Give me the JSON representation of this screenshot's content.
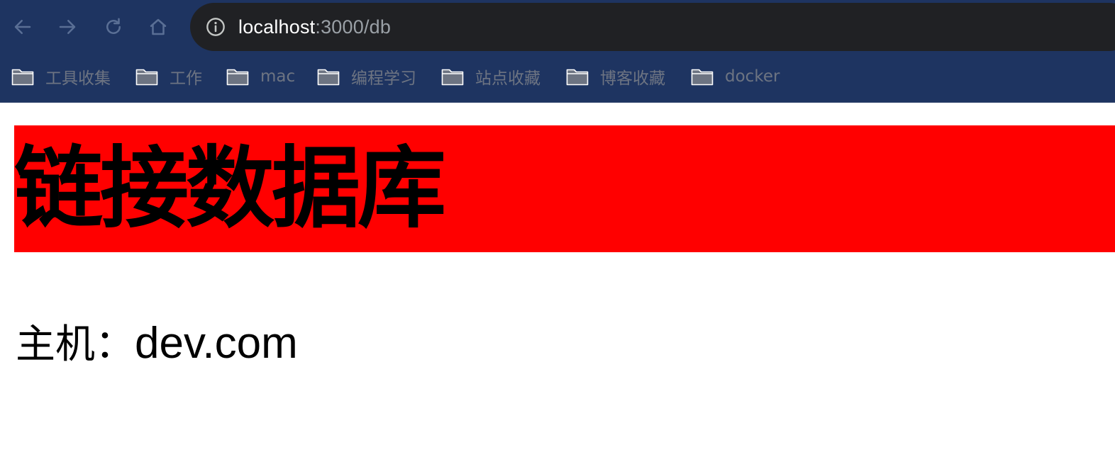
{
  "browser": {
    "address_bar": {
      "host": "localhost",
      "path": ":3000/db"
    },
    "bookmarks": [
      {
        "label": "工具收集",
        "icon": "folder-icon"
      },
      {
        "label": "工作",
        "icon": "folder-icon"
      },
      {
        "label": "mac",
        "icon": "folder-icon"
      },
      {
        "label": "编程学习",
        "icon": "folder-icon"
      },
      {
        "label": "站点收藏",
        "icon": "folder-icon"
      },
      {
        "label": "博客收藏",
        "icon": "folder-icon"
      },
      {
        "label": "docker",
        "icon": "folder-icon"
      }
    ],
    "nav_icons": [
      "back-arrow-icon",
      "forward-arrow-icon",
      "reload-icon",
      "home-icon",
      "info-icon"
    ]
  },
  "page": {
    "heading": "链接数据库",
    "host_label": "主机：",
    "host_value": "dev.com"
  },
  "colors": {
    "chrome_background": "#1e3461",
    "address_bar_background": "#202124",
    "heading_background": "#ff0000",
    "bookmark_text": "#6d7482"
  }
}
